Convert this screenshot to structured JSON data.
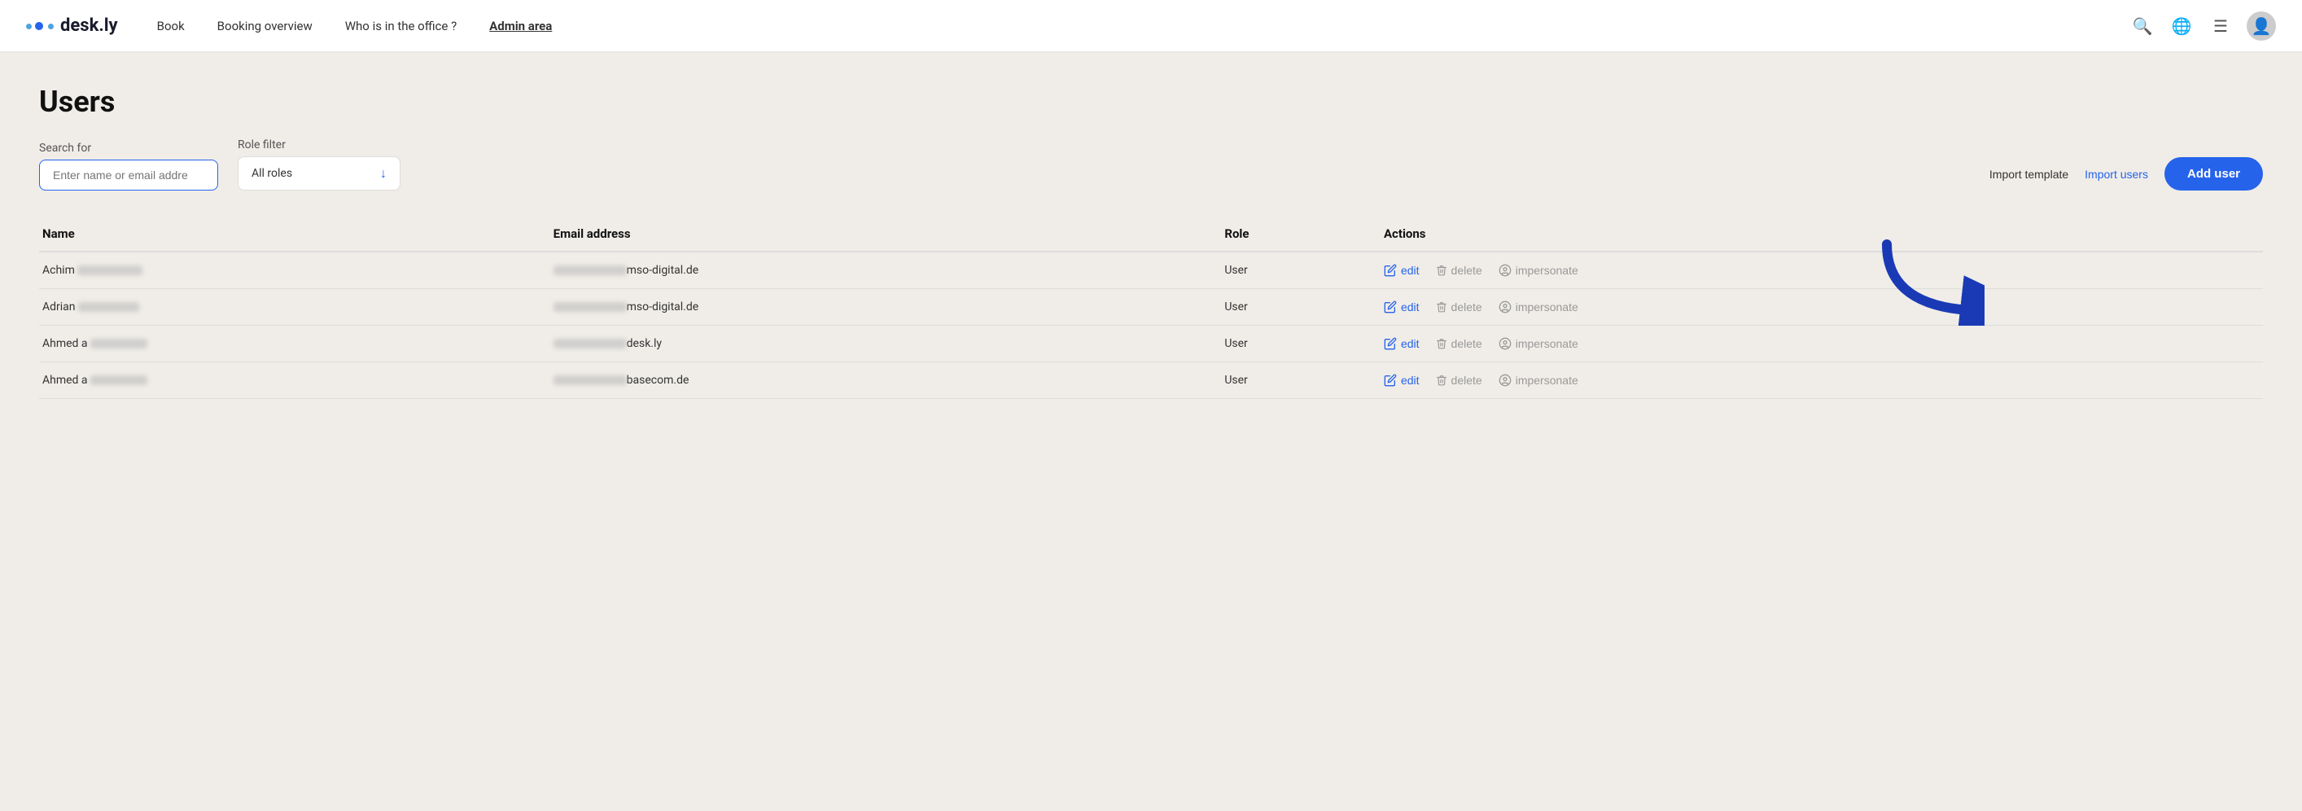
{
  "header": {
    "logo_text": "desk.ly",
    "nav_items": [
      {
        "label": "Book",
        "active": false
      },
      {
        "label": "Booking overview",
        "active": false
      },
      {
        "label": "Who is in the office ?",
        "active": false
      },
      {
        "label": "Admin area",
        "active": true
      }
    ]
  },
  "page": {
    "title": "Users",
    "search_label": "Search for",
    "search_placeholder": "Enter name or email addre",
    "role_filter_label": "Role filter",
    "role_filter_value": "All roles",
    "btn_import_template": "Import template",
    "btn_import_users": "Import users",
    "btn_add_user": "Add user"
  },
  "table": {
    "columns": [
      "Name",
      "Email address",
      "Role",
      "Actions"
    ],
    "rows": [
      {
        "name": "Achim",
        "name_blur_width": 80,
        "email_prefix_blur": true,
        "email_domain": "mso-digital.de",
        "role": "User"
      },
      {
        "name": "Adrian",
        "name_blur_width": 75,
        "email_prefix_blur": true,
        "email_domain": "mso-digital.de",
        "role": "User"
      },
      {
        "name": "Ahmed a",
        "name_blur_width": 70,
        "email_prefix_blur": true,
        "email_domain": "desk.ly",
        "role": "User"
      },
      {
        "name": "Ahmed a",
        "name_blur_width": 70,
        "email_prefix_blur": true,
        "email_domain": "basecom.de",
        "role": "User"
      }
    ],
    "action_labels": {
      "edit": "edit",
      "delete": "delete",
      "impersonate": "impersonate"
    }
  }
}
